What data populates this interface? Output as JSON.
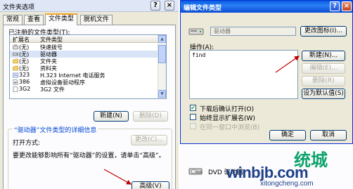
{
  "folder_options": {
    "title": "文件夹选项",
    "tabs": [
      "常规",
      "查看",
      "文件类型",
      "脱机文件"
    ],
    "registered_label": "已注册的文件类型(T):",
    "columns": [
      "扩展名",
      "文件类型"
    ],
    "rows": [
      {
        "ext": "(无)",
        "type": "快速拨号"
      },
      {
        "ext": "(无)",
        "type": "驱动器"
      },
      {
        "ext": "(无)",
        "type": "文件夹"
      },
      {
        "ext": "(无)",
        "type": "资料夹"
      },
      {
        "ext": "323",
        "type": "H.323 Internet 电话服务"
      },
      {
        "ext": "386",
        "type": "虚拟设备驱动程序"
      },
      {
        "ext": "3G2",
        "type": "3G2 文件"
      }
    ],
    "new_button": "新建(N)",
    "delete_button": "删除(D)",
    "details_group_title": "“驱动器”文件类型的详细信息",
    "opens_with_label": "打开方式:",
    "change_button": "更改(C)...",
    "details_text": "要更改能够影响所有“驱动器”的设置，请单击“高级”。",
    "advanced_button": "高级(V)"
  },
  "edit_file_type": {
    "title": "编辑文件类型",
    "type_name": "驱动器",
    "change_icon_button": "更改图标(I)...",
    "actions_label": "操作(A):",
    "actions": [
      "find"
    ],
    "new_button": "新建(N)...",
    "edit_button": "编辑(E)...",
    "delete_button": "删除(R)",
    "set_default_button": "设为默认值(S)",
    "checkboxes": [
      {
        "label": "下载后确认打开(O)",
        "checked": true,
        "disabled": false
      },
      {
        "label": "始终显示扩展名(W)",
        "checked": false,
        "disabled": false
      },
      {
        "label": "在同一窗口中浏览(B)",
        "checked": false,
        "disabled": true
      }
    ],
    "ok_button": "确定",
    "cancel_button": "取消"
  },
  "background_item": {
    "label": "DVD 驱动器"
  },
  "watermark": {
    "main": "winbjb.com",
    "sub": "xitongcheng.com",
    "cn": "统城"
  },
  "colors": {
    "xp_face": "#ece9d8",
    "xp_blue_title": "#0a5fe0",
    "tab_highlight": "#f5a623",
    "annotation_arrow": "#c00000",
    "watermark_blue": "#1e3f8a",
    "watermark_green": "#0ea36b"
  }
}
